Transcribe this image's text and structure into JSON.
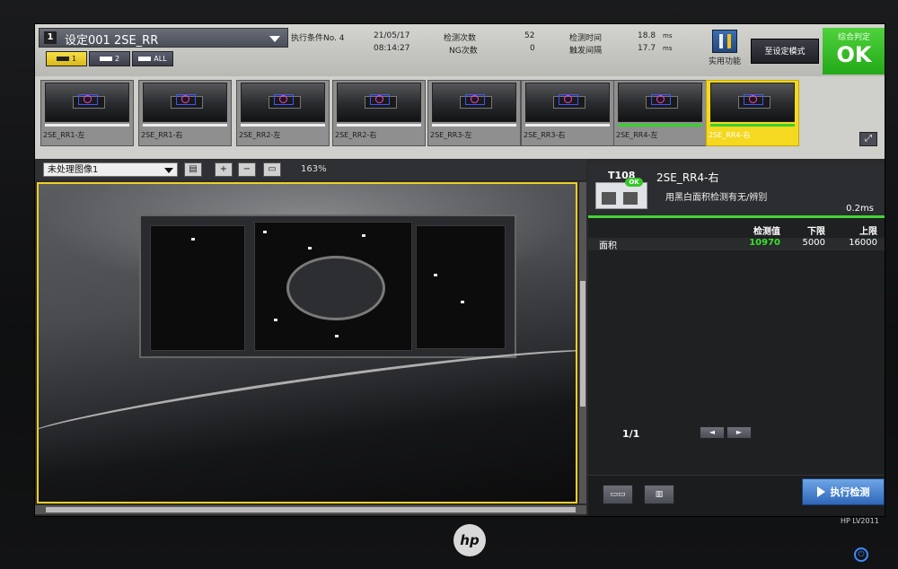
{
  "header": {
    "condition_num": "1",
    "condition_name": "设定001 2SE_RR",
    "cam_tabs": [
      {
        "label": "1",
        "active": true
      },
      {
        "label": "2",
        "active": false
      },
      {
        "label": "ALL",
        "active": false
      }
    ],
    "exec_condition": "执行条件No. 4",
    "date": "21/05/17",
    "time": "08:14:27",
    "inspect_count_label": "检测次数",
    "inspect_count": "52",
    "ng_count_label": "NG次数",
    "ng_count": "0",
    "inspect_time_label": "检测时间",
    "inspect_time": "18.8",
    "inspect_time_unit": "ms",
    "trigger_interval_label": "触发间隔",
    "trigger_interval": "17.7",
    "trigger_interval_unit": "ms",
    "utility_label": "实用功能",
    "setting_mode_label": "至设定模式",
    "judge_label": "综合判定",
    "judge_value": "OK"
  },
  "thumbnails": [
    {
      "label": "2SE_RR1-左",
      "selected": false,
      "ok_bar": false
    },
    {
      "label": "2SE_RR1-右",
      "selected": false,
      "ok_bar": false
    },
    {
      "label": "2SE_RR2-左",
      "selected": false,
      "ok_bar": false
    },
    {
      "label": "2SE_RR2-右",
      "selected": false,
      "ok_bar": false
    },
    {
      "label": "2SE_RR3-左",
      "selected": false,
      "ok_bar": false
    },
    {
      "label": "2SE_RR3-右",
      "selected": false,
      "ok_bar": false
    },
    {
      "label": "2SE_RR4-左",
      "selected": false,
      "ok_bar": true
    },
    {
      "label": "2SE_RR4-右",
      "selected": true,
      "ok_bar": true
    }
  ],
  "image_toolbar": {
    "image_select": "未处理图像1",
    "zoom": "163%"
  },
  "tool_panel": {
    "tool_id": "T108",
    "tool_name": "2SE_RR4-右",
    "tool_desc": "用黑白面积检测有无/辨别",
    "tool_time": "0.2ms",
    "ok_badge": "OK",
    "columns": {
      "name": "",
      "value": "检测值",
      "lower": "下限",
      "upper": "上限"
    },
    "rows": [
      {
        "name": "面积",
        "value": "10970",
        "lower": "5000",
        "upper": "16000"
      }
    ],
    "page": "1/1",
    "prev_glyph": "◄",
    "next_glyph": "►",
    "exec_label": "执行检测"
  },
  "bezel": {
    "logo": "hp",
    "model": "HP LV2011"
  },
  "colors": {
    "ok_green": "#36d22c",
    "select_yellow": "#f5d820",
    "exec_blue": "#2f67b8"
  }
}
